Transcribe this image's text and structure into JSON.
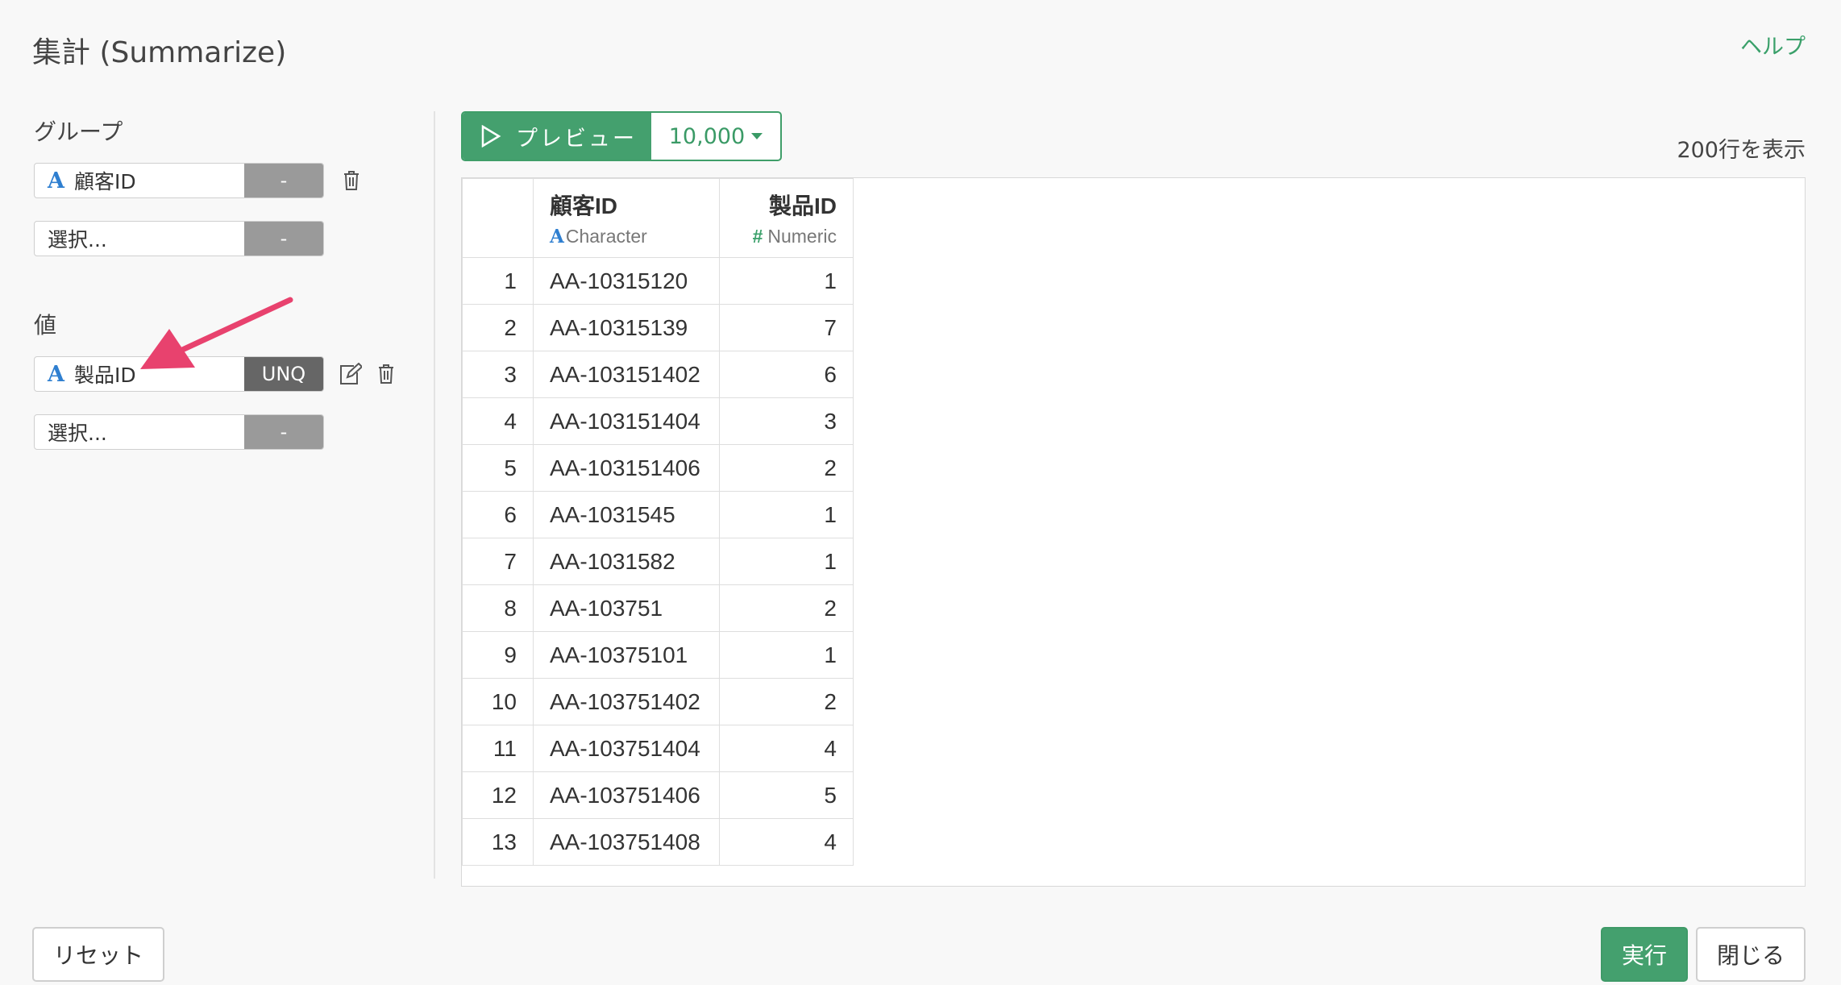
{
  "header": {
    "title": "集計 (Summarize)",
    "help_label": "ヘルプ"
  },
  "group": {
    "label": "グループ",
    "rows": [
      {
        "column": "顧客ID",
        "type_icon": "A",
        "agg": "-"
      },
      {
        "placeholder": "選択...",
        "agg": "-"
      }
    ]
  },
  "values": {
    "label": "値",
    "rows": [
      {
        "column": "製品ID",
        "type_icon": "A",
        "agg": "UNQ"
      },
      {
        "placeholder": "選択...",
        "agg": "-"
      }
    ]
  },
  "preview": {
    "button_label": "プレビュー",
    "row_limit": "10,000",
    "rows_shown": "200行を表示"
  },
  "table": {
    "columns": [
      {
        "name": "顧客ID",
        "type_icon": "A",
        "type": "Character"
      },
      {
        "name": "製品ID",
        "type_icon": "#",
        "type": "Numeric"
      }
    ],
    "rows": [
      [
        "1",
        "AA-10315120",
        "1"
      ],
      [
        "2",
        "AA-10315139",
        "7"
      ],
      [
        "3",
        "AA-103151402",
        "6"
      ],
      [
        "4",
        "AA-103151404",
        "3"
      ],
      [
        "5",
        "AA-103151406",
        "2"
      ],
      [
        "6",
        "AA-1031545",
        "1"
      ],
      [
        "7",
        "AA-1031582",
        "1"
      ],
      [
        "8",
        "AA-103751",
        "2"
      ],
      [
        "9",
        "AA-10375101",
        "1"
      ],
      [
        "10",
        "AA-103751402",
        "2"
      ],
      [
        "11",
        "AA-103751404",
        "4"
      ],
      [
        "12",
        "AA-103751406",
        "5"
      ],
      [
        "13",
        "AA-103751408",
        "4"
      ]
    ]
  },
  "footer": {
    "reset_label": "リセット",
    "run_label": "実行",
    "close_label": "閉じる"
  },
  "colors": {
    "accent_green": "#44a06e",
    "type_blue": "#2f7fd0",
    "annotation_arrow": "#e8426e"
  }
}
